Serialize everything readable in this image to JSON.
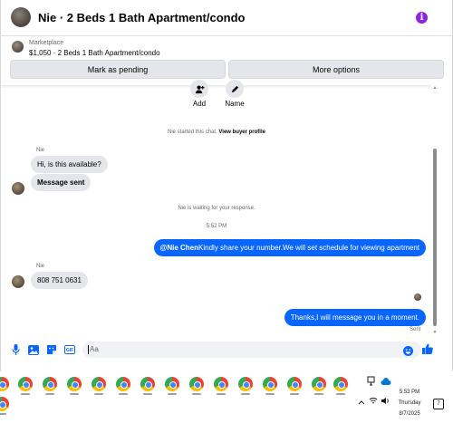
{
  "header": {
    "title": "Nie · 2 Beds 1 Bath Apartment/condo",
    "info_icon": "info-icon",
    "info_glyph": "i",
    "accent_color": "#8e24db"
  },
  "listing": {
    "label": "Marketplace",
    "price_title": "$1,050 · 2 Beds 1 Bath Apartment/condo",
    "pending_button": "Mark as pending",
    "more_button": "More options"
  },
  "actions": [
    {
      "label": "Add",
      "icon": "add-person-icon"
    },
    {
      "label": "Name",
      "icon": "pencil-icon"
    }
  ],
  "conversation": {
    "started_text": "Nie started this chat.",
    "view_profile": "View buyer profile",
    "sender_name": "Nie",
    "msg1": "Hi, is this available?",
    "msg2": "Message sent",
    "waiting_text": "Nie is waiting for your response.",
    "timestamp": "5:52 PM",
    "out1_mention": "@Nie Chen",
    "out1_text": "Kindly share your number.We will set schedule for viewing apartment",
    "sender_name2": "Nie",
    "msg3": "808 751 0631",
    "out2_text": "Thanks,I will message you in a moment.",
    "sent_label": "Sent",
    "bubble_color": "#0866ff"
  },
  "composer": {
    "placeholder": "Aa",
    "icons": [
      "microphone-icon",
      "image-icon",
      "sticker-icon",
      "gif-icon",
      "emoji-icon",
      "thumbs-up-icon"
    ],
    "gif_label": "GIF"
  },
  "taskbar": {
    "time": "5:53 PM",
    "day": "Thursday",
    "date": "8/7/2025",
    "notification_count": "7",
    "tray_icons": [
      "chevron-up-icon",
      "wifi-icon",
      "speaker-icon",
      "meet-icon",
      "cloud-icon"
    ]
  }
}
